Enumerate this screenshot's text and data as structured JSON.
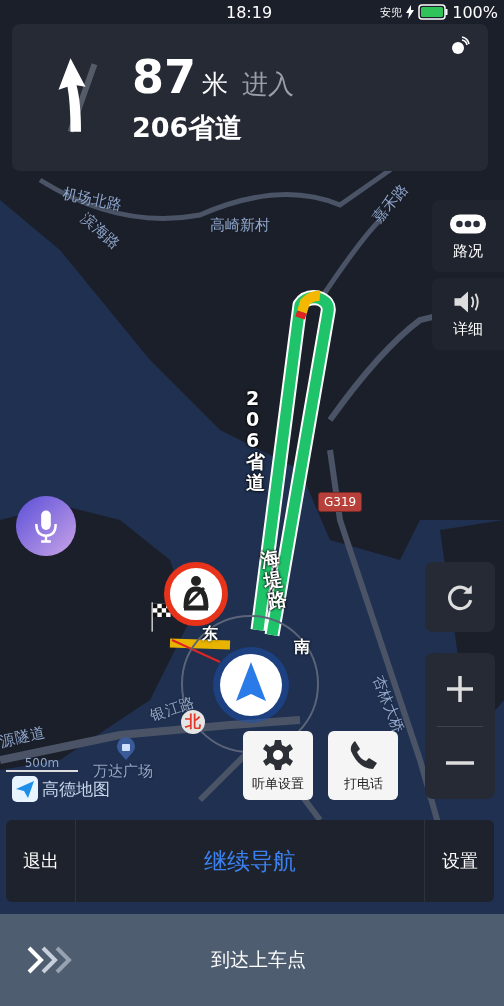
{
  "status_bar": {
    "time": "18:19",
    "carrier": "安兜",
    "battery": "100%"
  },
  "guidance": {
    "distance": "87",
    "unit": "米",
    "action": "进入",
    "road": "206省道"
  },
  "side_buttons": [
    {
      "kind": "traffic",
      "label": "路况"
    },
    {
      "kind": "volume",
      "label": "详细"
    }
  ],
  "map_labels": [
    {
      "text": "机场北路"
    },
    {
      "text": "滨海路"
    },
    {
      "text": "高崎新村"
    },
    {
      "text": "嘉禾路"
    },
    {
      "text": "206省道"
    },
    {
      "text": "海堤路"
    },
    {
      "text": "G319"
    },
    {
      "text": "杏林大桥"
    },
    {
      "text": "银江路"
    },
    {
      "text": "源隧道"
    },
    {
      "text": "万达广场"
    }
  ],
  "compass": {
    "east": "东",
    "south": "南",
    "north": "北"
  },
  "scale": "500m",
  "logo": "高德地图",
  "action_buttons": [
    {
      "kind": "settings",
      "label": "听单设置"
    },
    {
      "kind": "phone",
      "label": "打电话"
    }
  ],
  "nav_bar": {
    "exit": "退出",
    "continue": "继续导航",
    "settings": "设置"
  },
  "slider": {
    "label": "到达上车点"
  }
}
